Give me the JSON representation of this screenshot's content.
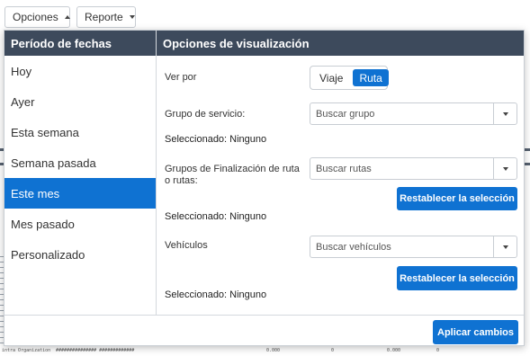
{
  "toolbar": {
    "options_label": "Opciones",
    "report_label": "Reporte"
  },
  "period": {
    "header": "Período de fechas",
    "items": [
      {
        "label": "Hoy"
      },
      {
        "label": "Ayer"
      },
      {
        "label": "Esta semana"
      },
      {
        "label": "Semana pasada"
      },
      {
        "label": "Este mes",
        "active": true
      },
      {
        "label": "Mes pasado"
      },
      {
        "label": "Personalizado"
      }
    ]
  },
  "display": {
    "header": "Opciones de visualización",
    "view_by_label": "Ver por",
    "view_by_options": [
      "Viaje",
      "Ruta"
    ],
    "view_by_selected": "Ruta",
    "service_group_label": "Grupo de servicio:",
    "service_group_placeholder": "Buscar grupo",
    "service_group_selected": "Seleccionado: Ninguno",
    "route_groups_label": "Grupos de Finalización de ruta o rutas:",
    "route_groups_placeholder": "Buscar rutas",
    "route_groups_reset": "Restablecer la selección",
    "route_groups_selected": "Seleccionado: Ninguno",
    "vehicles_label": "Vehículos",
    "vehicles_placeholder": "Buscar vehículos",
    "vehicles_reset": "Restablecer la selección",
    "vehicles_selected": "Seleccionado: Ninguno"
  },
  "footer": {
    "apply_label": "Aplicar cambios"
  },
  "background": {
    "row_text": "intra Organization",
    "row_hash": "############### #############",
    "row_val1": "0.000",
    "row_val2": "0",
    "row_val3": "0.000",
    "row_val4": "0"
  },
  "colors": {
    "header_bg": "#3d4a5c",
    "accent": "#0f72d2"
  }
}
